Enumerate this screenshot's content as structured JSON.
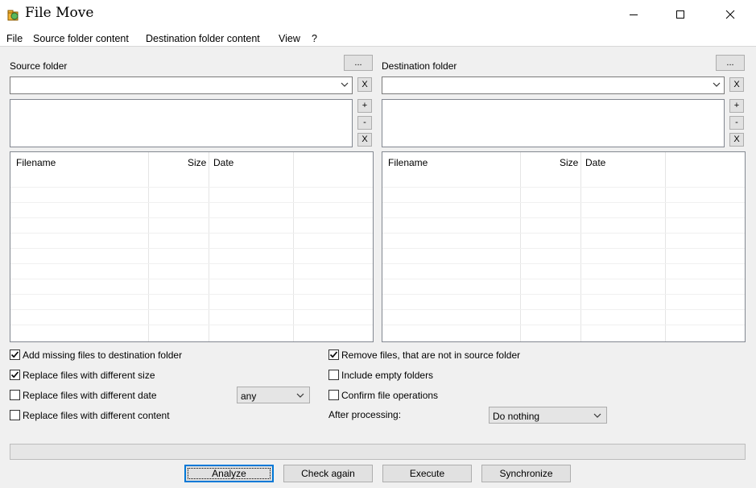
{
  "window": {
    "title": "File Move"
  },
  "menu": [
    "File",
    "Source folder content",
    "Destination folder content",
    "View",
    "?"
  ],
  "source": {
    "label": "Source folder",
    "browse_label": "...",
    "clear_label": "X",
    "add_label": "+",
    "remove_label": "-",
    "clear_list_label": "X",
    "columns": [
      "Filename",
      "Size",
      "Date"
    ]
  },
  "destination": {
    "label": "Destination folder",
    "browse_label": "...",
    "clear_label": "X",
    "add_label": "+",
    "remove_label": "-",
    "clear_list_label": "X",
    "columns": [
      "Filename",
      "Size",
      "Date"
    ]
  },
  "options": {
    "add_missing": {
      "label": "Add missing files to destination folder",
      "checked": true
    },
    "replace_size": {
      "label": "Replace files with different size",
      "checked": true
    },
    "replace_date": {
      "label": "Replace files with different date",
      "checked": false
    },
    "replace_content": {
      "label": "Replace files with different content",
      "checked": false
    },
    "remove_files": {
      "label": "Remove files, that are not in source folder",
      "checked": true
    },
    "include_empty": {
      "label": "Include empty folders",
      "checked": false
    },
    "confirm_ops": {
      "label": "Confirm file operations",
      "checked": false
    }
  },
  "date_mode": {
    "value": "any"
  },
  "after_processing": {
    "label": "After processing:",
    "value": "Do nothing"
  },
  "buttons": {
    "analyze": "Analyze",
    "check_again": "Check again",
    "execute": "Execute",
    "synchronize": "Synchronize"
  },
  "colors": {
    "accent": "#0078d7",
    "background": "#f0f0f0"
  }
}
